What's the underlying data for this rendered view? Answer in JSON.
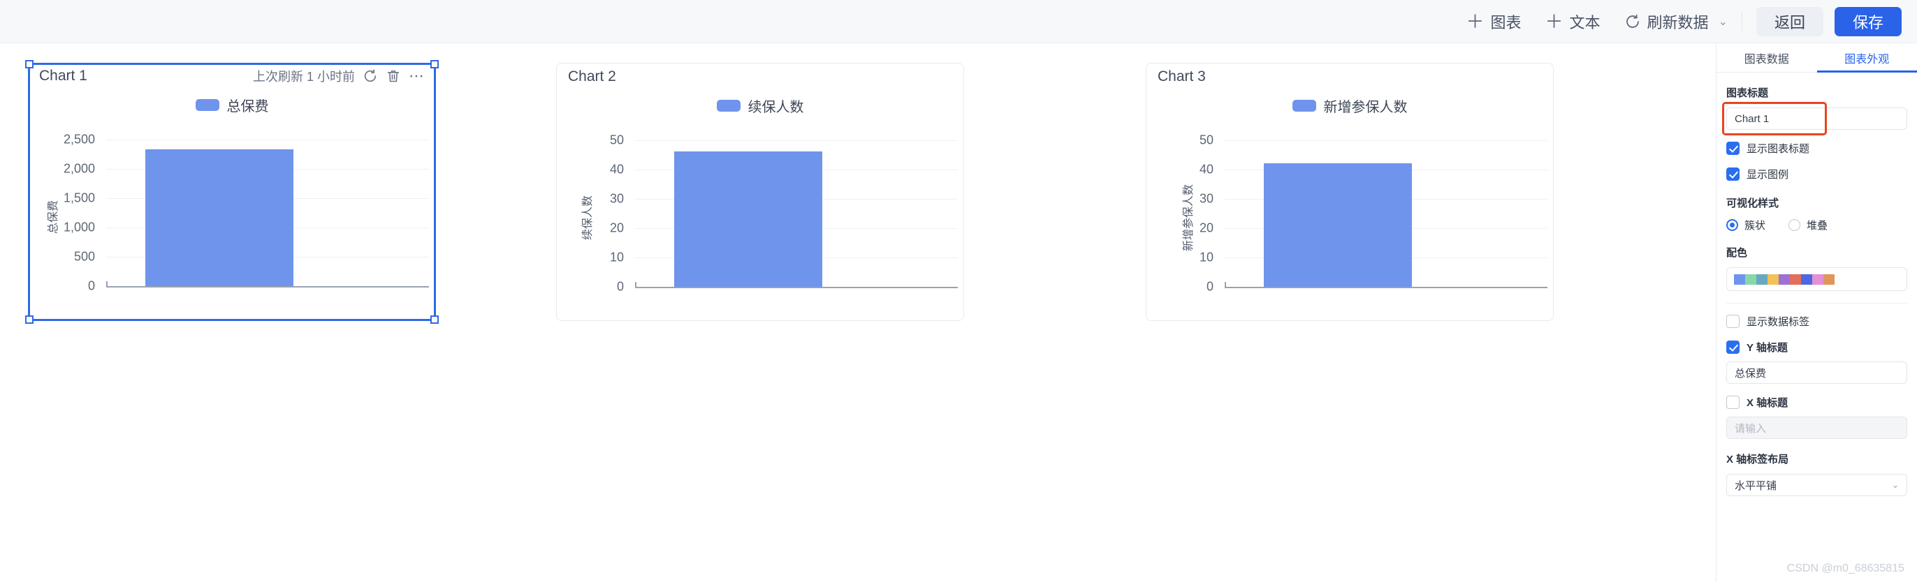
{
  "toolbar": {
    "add_chart": "图表",
    "add_text": "文本",
    "refresh_data": "刷新数据",
    "caret": "⌄",
    "back": "返回",
    "save": "保存"
  },
  "canvas": {
    "charts": [
      {
        "title": "Chart 1",
        "selected": true,
        "refresh_note": "上次刷新 1 小时前",
        "legend": "总保费",
        "ylabel": "总保费",
        "yticks": [
          "2,500",
          "2,000",
          "1,500",
          "1,000",
          "500",
          "0"
        ],
        "bar_value": 2400
      },
      {
        "title": "Chart 2",
        "selected": false,
        "refresh_note": "",
        "legend": "续保人数",
        "ylabel": "续保人数",
        "yticks": [
          "50",
          "40",
          "30",
          "20",
          "10",
          "0"
        ],
        "bar_value": 46
      },
      {
        "title": "Chart 3",
        "selected": false,
        "refresh_note": "",
        "legend": "新增参保人数",
        "ylabel": "新增参保人数",
        "yticks": [
          "50",
          "40",
          "30",
          "20",
          "10",
          "0"
        ],
        "bar_value": 42
      }
    ]
  },
  "chart_data": [
    {
      "type": "bar",
      "title": "Chart 1",
      "categories": [
        ""
      ],
      "series": [
        {
          "name": "总保费",
          "values": [
            2400
          ]
        }
      ],
      "xlabel": "",
      "ylabel": "总保费",
      "ylim": [
        0,
        2500
      ],
      "yticks": [
        0,
        500,
        1000,
        1500,
        2000,
        2500
      ],
      "grid": true,
      "legend_position": "top-center",
      "color": "#6f94ec"
    },
    {
      "type": "bar",
      "title": "Chart 2",
      "categories": [
        ""
      ],
      "series": [
        {
          "name": "续保人数",
          "values": [
            46
          ]
        }
      ],
      "xlabel": "",
      "ylabel": "续保人数",
      "ylim": [
        0,
        50
      ],
      "yticks": [
        0,
        10,
        20,
        30,
        40,
        50
      ],
      "grid": true,
      "legend_position": "top-center",
      "color": "#6f94ec"
    },
    {
      "type": "bar",
      "title": "Chart 3",
      "categories": [
        ""
      ],
      "series": [
        {
          "name": "新增参保人数",
          "values": [
            42
          ]
        }
      ],
      "xlabel": "",
      "ylabel": "新增参保人数",
      "ylim": [
        0,
        50
      ],
      "yticks": [
        0,
        10,
        20,
        30,
        40,
        50
      ],
      "grid": true,
      "legend_position": "top-center",
      "color": "#6f94ec"
    }
  ],
  "panel": {
    "tabs": [
      {
        "label": "图表数据",
        "active": false
      },
      {
        "label": "图表外观",
        "active": true
      }
    ],
    "chart_title_label": "图表标题",
    "chart_title_value": "Chart 1",
    "show_chart_title": "显示图表标题",
    "show_legend": "显示图例",
    "viz_style_label": "可视化样式",
    "viz_cluster": "簇状",
    "viz_stacked": "堆叠",
    "palette_label": "配色",
    "palette_colors": [
      "#6f94ec",
      "#85d9a8",
      "#6aa8c0",
      "#f2c257",
      "#9d72d4",
      "#e0705b",
      "#4e68e0",
      "#e58fd5",
      "#e0955c"
    ],
    "show_data_labels": "显示数据标签",
    "y_axis_title": "Y 轴标题",
    "y_axis_value": "总保费",
    "x_axis_title": "X 轴标题",
    "x_axis_placeholder": "请输入",
    "x_label_layout_title": "X 轴标签布局",
    "x_label_layout_value": "水平平铺"
  },
  "watermark": "CSDN @m0_68635815"
}
